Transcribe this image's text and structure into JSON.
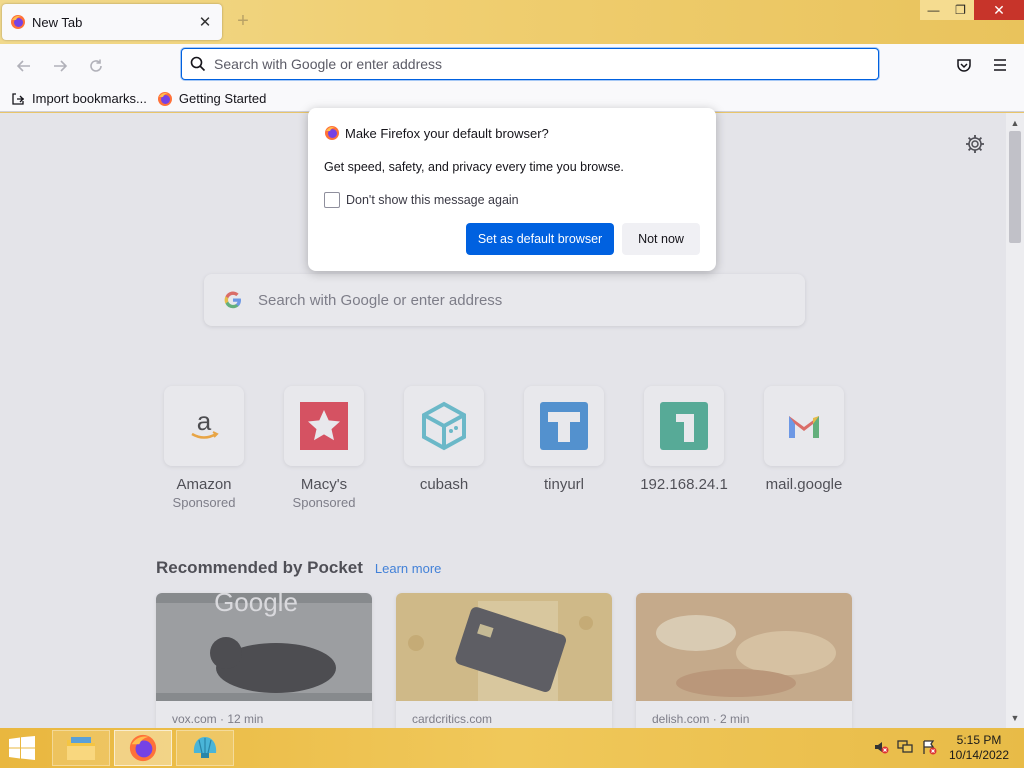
{
  "window": {
    "tab_title": "New Tab",
    "tab_close": "✕",
    "new_tab": "+",
    "minimize": "—",
    "maximize": "❐",
    "close": "✕"
  },
  "nav": {
    "url_placeholder": "Search with Google or enter address"
  },
  "bookmarks": [
    {
      "label": "Import bookmarks...",
      "icon": "import-icon"
    },
    {
      "label": "Getting Started",
      "icon": "firefox-icon"
    }
  ],
  "newtab": {
    "search_placeholder": "Search with Google or enter address",
    "shortcuts": [
      {
        "name": "Amazon",
        "sponsored": "Sponsored",
        "icon": "amazon-icon"
      },
      {
        "name": "Macy's",
        "sponsored": "Sponsored",
        "icon": "macys-icon"
      },
      {
        "name": "cubash",
        "sponsored": "",
        "icon": "cubash-icon"
      },
      {
        "name": "tinyurl",
        "sponsored": "",
        "icon": "tinyurl-icon"
      },
      {
        "name": "192.168.24.1",
        "sponsored": "",
        "icon": "numeric-1-icon"
      },
      {
        "name": "mail.google",
        "sponsored": "",
        "icon": "gmail-icon"
      }
    ],
    "pocket": {
      "heading": "Recommended by Pocket",
      "learn_more": "Learn more",
      "cards": [
        {
          "source": "vox.com · 12 min",
          "image": "google-sign-with-dog"
        },
        {
          "source": "cardcritics.com",
          "image": "credit-card-on-gold"
        },
        {
          "source": "delish.com · 2 min",
          "image": "sliced-chicken"
        }
      ]
    }
  },
  "dialog": {
    "title": "Make Firefox your default browser?",
    "body": "Get speed, safety, and privacy every time you browse.",
    "checkbox_label": "Don't show this message again",
    "primary_button": "Set as default browser",
    "secondary_button": "Not now"
  },
  "taskbar": {
    "time": "5:15 PM",
    "date": "10/14/2022",
    "apps": [
      "file-explorer-icon",
      "firefox-icon",
      "shell-icon"
    ]
  },
  "colors": {
    "accent": "#0061e0",
    "titlebar": "#f0cf72",
    "taskbar": "#e9b73f"
  }
}
